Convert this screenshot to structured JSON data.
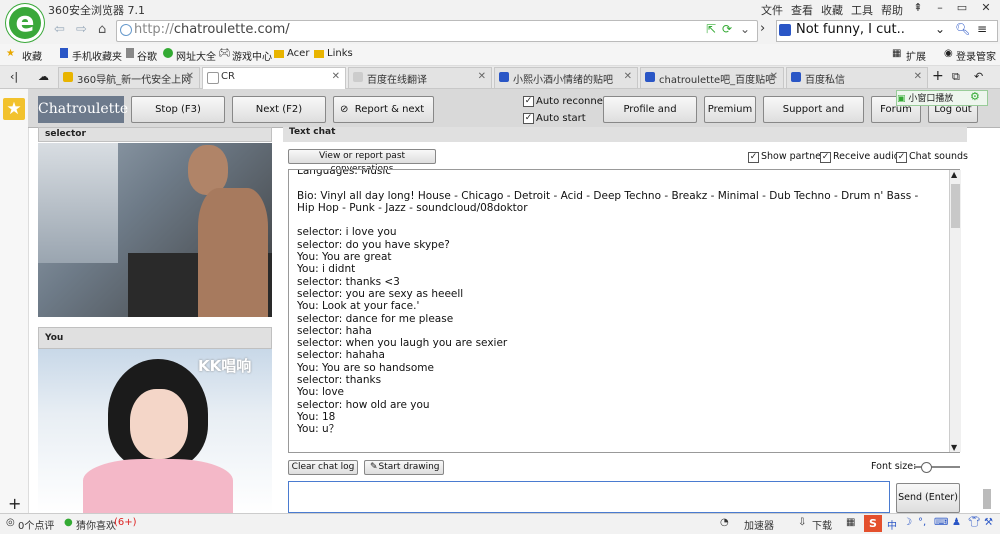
{
  "browser": {
    "title": "360安全浏览器 7.1",
    "menu": [
      "文件",
      "查看",
      "收藏",
      "工具",
      "帮助"
    ],
    "url": "chatroulette.com/",
    "url_scheme": "http://",
    "search_text": "Not funny, I cut..",
    "extension_label": "扩展",
    "login_label": "登录管家",
    "bookmarks": [
      "收藏",
      "手机收藏夹",
      "谷歌",
      "网址大全",
      "游戏中心",
      "Acer",
      "Links"
    ],
    "tabs": [
      {
        "label": "360导航_新一代安全上网",
        "color": "#e8b400"
      },
      {
        "label": "CR",
        "color": "#ffffff"
      },
      {
        "label": "百度在线翻译",
        "color": "#cccccc"
      },
      {
        "label": "小熙小酒小情绪的贴吧",
        "color": "#2a56c6"
      },
      {
        "label": "chatroulette吧_百度贴吧",
        "color": "#2a56c6"
      },
      {
        "label": "百度私信",
        "color": "#2a56c6"
      }
    ],
    "mini_window_label": "小窗口播放",
    "status": {
      "comments": "0个点评",
      "guess": "猜你喜欢",
      "guess_count": "(6+)",
      "accelerator": "加速器",
      "download": "下载",
      "ime_label": "中"
    }
  },
  "cr": {
    "logo": "Chatroulette",
    "buttons": {
      "stop": "Stop (F3)",
      "next": "Next (F2)",
      "report_next": "Report & next (F4)",
      "profile": "Profile and settings",
      "premium": "Premium",
      "support": "Support and contacts",
      "forum": "Forum",
      "logout": "Log out",
      "view_report": "View or report past conversations",
      "clear": "Clear chat log",
      "draw": "Start drawing",
      "send": "Send (Enter)"
    },
    "options": {
      "auto_reconnect": "Auto reconnect",
      "auto_start": "Auto start",
      "show_partner": "Show partner",
      "receive_audio": "Receive audio",
      "chat_sounds": "Chat sounds",
      "font_size": "Font size:"
    },
    "partner_label": "selector",
    "you_label": "You",
    "video_watermark": "KK唱响",
    "chat_header": "Text chat",
    "chat_lines": [
      "Languages: Music",
      "",
      "Bio: Vinyl all day long! House - Chicago - Detroit - Acid - Deep Techno - Breakz - Minimal - Dub Techno - Drum n' Bass - Hip Hop - Punk - Jazz - soundcloud/08doktor",
      "",
      "selector: i love you",
      "selector: do you have skype?",
      "You: You are great",
      "You: i didnt",
      "selector: thanks <3",
      "selector: you are sexy as heeell",
      "You: Look at your face.'",
      "selector: dance for me please",
      "selector: haha",
      "selector: when you laugh you are sexier",
      "selector: hahaha",
      "You: You are so handsome",
      "selector: thanks",
      "You: love",
      "selector: how old are you",
      "You: 18",
      "You: u？"
    ]
  }
}
